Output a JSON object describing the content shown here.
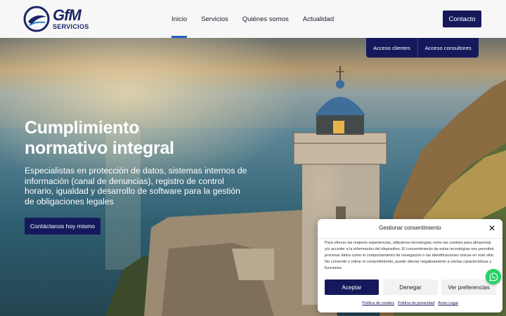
{
  "brand": {
    "name": "GfM",
    "tagline": "SERVICIOS",
    "primary_color": "#15195c",
    "accent_color": "#1f5fc4"
  },
  "nav": {
    "items": [
      {
        "label": "Inicio",
        "active": true
      },
      {
        "label": "Servicios",
        "active": false
      },
      {
        "label": "Quiénes somos",
        "active": false
      },
      {
        "label": "Actualidad",
        "active": false
      }
    ],
    "contact_label": "Contacto"
  },
  "access": {
    "clients_label": "Acceso clientes",
    "consultants_label": "Acceso consultores"
  },
  "hero": {
    "title_line1": "Cumplimiento",
    "title_line2": "normativo integral",
    "subtitle": "Especialistas en protección de datos, sistemas internos de información (canal de denuncias), registro de control horario, igualdad y desarrollo de software para la gestión de obligaciones legales",
    "cta_label": "Contáctanos hoy mismo"
  },
  "cookie": {
    "title": "Gestionar consentimiento",
    "body": "Para ofrecer las mejores experiencias, utilizamos tecnologías como las cookies para almacenar y/o acceder a la información del dispositivo. El consentimiento de estas tecnologías nos permitirá procesar datos como el comportamiento de navegación o las identificaciones únicas en este sitio. No consentir o retirar el consentimiento, puede afectar negativamente a ciertas características y funciones.",
    "accept_label": "Aceptar",
    "deny_label": "Denegar",
    "prefs_label": "Ver preferencias",
    "links": [
      "Política de cookies",
      "Política de privacidad",
      "Aviso Legal"
    ]
  },
  "icons": {
    "close": "close-icon",
    "whatsapp": "whatsapp-icon",
    "logo": "gfm-logo-icon"
  }
}
